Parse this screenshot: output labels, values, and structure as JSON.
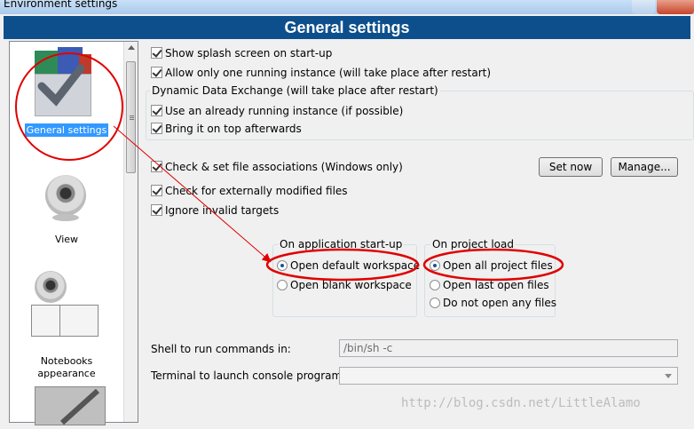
{
  "window": {
    "title": "Environment settings"
  },
  "header": {
    "title": "General settings"
  },
  "sidebar": {
    "items": [
      {
        "label": "General settings",
        "icon": "general-settings-icon",
        "selected": true
      },
      {
        "label": "View",
        "icon": "webcam-icon"
      },
      {
        "label": "Notebooks\nappearance",
        "icon": "notebooks-icon"
      },
      {
        "label": "",
        "icon": "pen-tool-icon"
      }
    ]
  },
  "options": {
    "splash": {
      "label": "Show splash screen on start-up",
      "checked": true
    },
    "single_instance": {
      "label": "Allow only one running instance (will take place after restart)",
      "checked": true
    },
    "dde_group": {
      "caption": "Dynamic Data Exchange (will take place after restart)",
      "use_running": {
        "label": "Use an already running instance (if possible)",
        "checked": true
      },
      "bring_top": {
        "label": "Bring it on top afterwards",
        "checked": true
      }
    },
    "file_assoc": {
      "label": "Check & set file associations (Windows only)",
      "checked": true,
      "set_now": "Set now",
      "manage": "Manage..."
    },
    "ext_modified": {
      "label": "Check for externally modified files",
      "checked": true
    },
    "ignore_invalid": {
      "label": "Ignore invalid targets",
      "checked": true
    }
  },
  "startup_group": {
    "caption": "On application start-up",
    "options": [
      "Open default workspace",
      "Open blank workspace"
    ],
    "selected": 0
  },
  "project_group": {
    "caption": "On project load",
    "options": [
      "Open all project files",
      "Open last open files",
      "Do not open any files"
    ],
    "selected": 0
  },
  "shell": {
    "label": "Shell to run commands in:",
    "value": "/bin/sh -c"
  },
  "terminal": {
    "label": "Terminal to launch console programs:",
    "value": ""
  },
  "watermark": "http://blog.csdn.net/LittleAlamo",
  "colors": {
    "header": "#0c4f8c",
    "selection": "#3399ff",
    "annotation": "#e00000"
  }
}
